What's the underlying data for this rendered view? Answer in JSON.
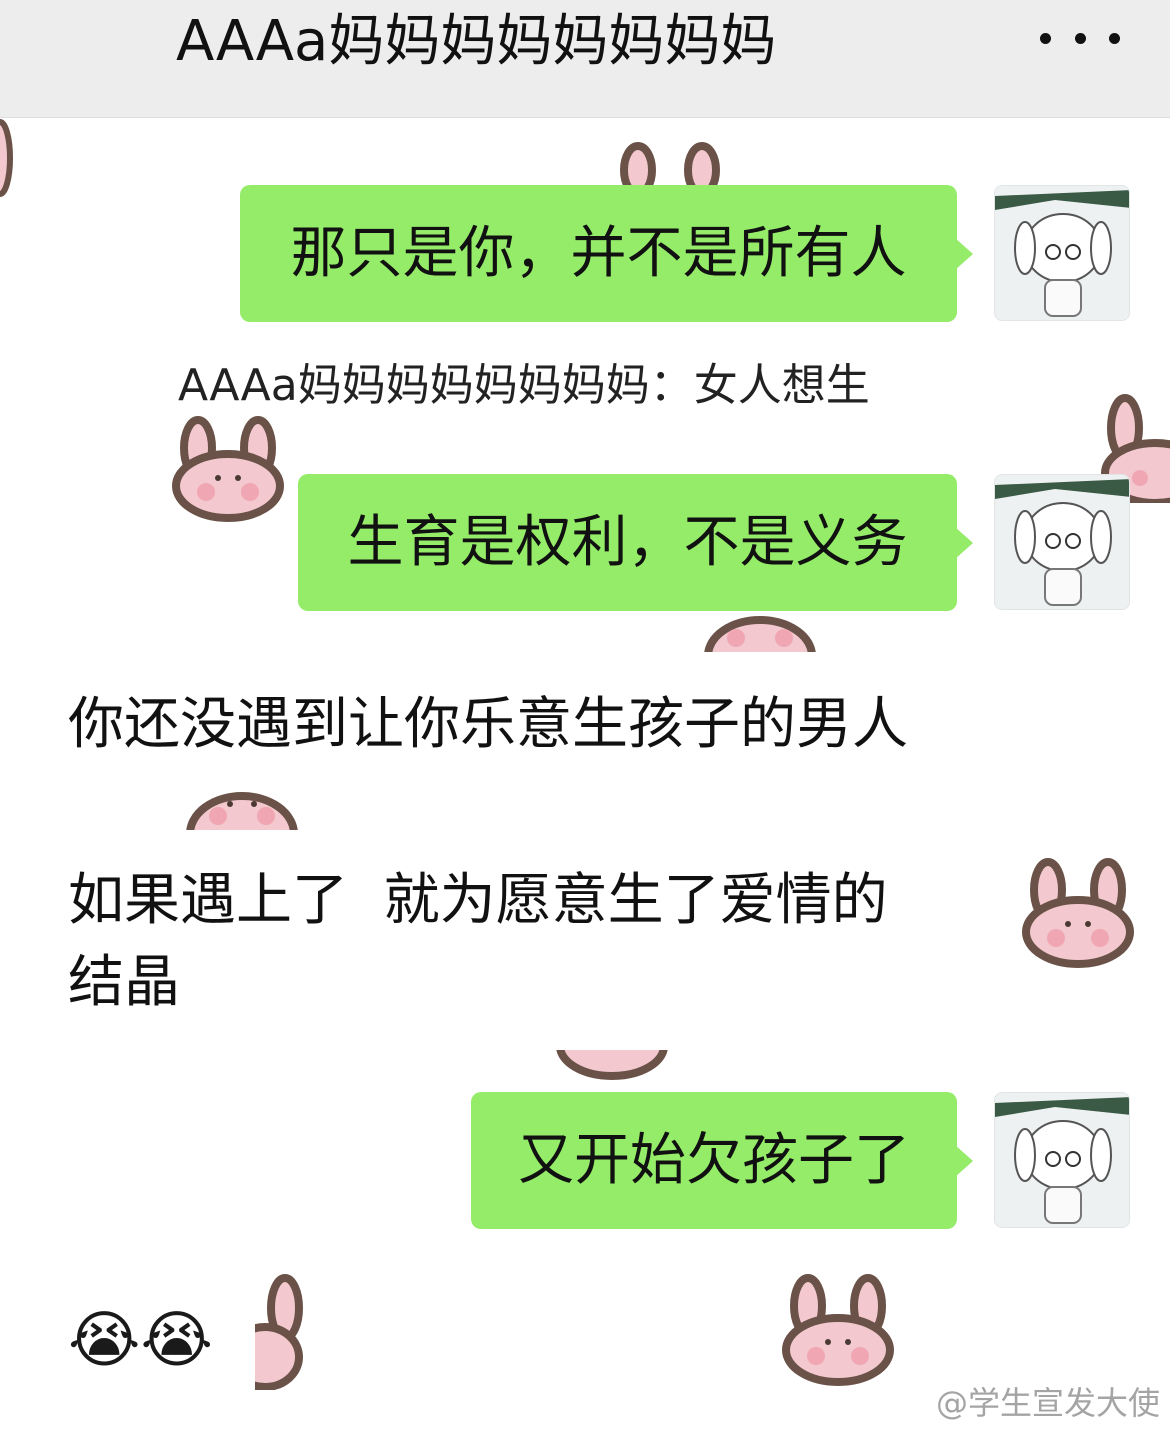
{
  "header": {
    "title": "AAAa妈妈妈妈妈妈妈妈",
    "more_icon": "more-dots-icon"
  },
  "messages": [
    {
      "side": "right",
      "text": "那只是你，并不是所有人"
    },
    {
      "type": "system",
      "text": "AAAa妈妈妈妈妈妈妈妈：女人想生"
    },
    {
      "side": "right",
      "text": "生育是权利，不是义务"
    },
    {
      "side": "left",
      "text": "你还没遇到让你乐意生孩子的男人"
    },
    {
      "side": "left",
      "lines": [
        "如果遇上了  就为愿意生了爱情的",
        "结晶"
      ]
    },
    {
      "side": "right",
      "text": "又开始欠孩子了"
    },
    {
      "side": "left",
      "emoji": "😭😭"
    }
  ],
  "watermark": "@学生宣发大使",
  "colors": {
    "bubble": "#95ec69",
    "header_bg": "#ededed",
    "bunny_fill": "#f3c9cf",
    "bunny_outline": "#6a5248"
  },
  "icons": {
    "avatar": "bunny-hat-character-avatar",
    "sticker": "pink-bunny-sticker",
    "emoji": "crying-laughing-emoji"
  }
}
